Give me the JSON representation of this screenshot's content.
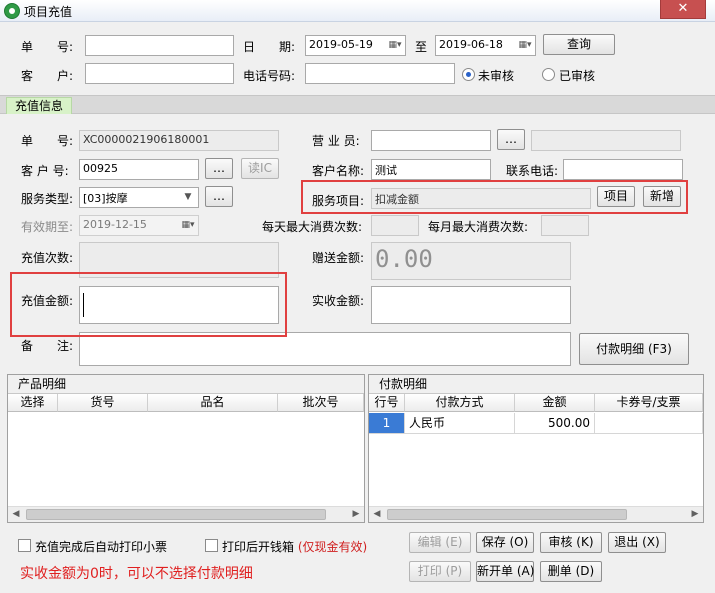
{
  "window": {
    "title": "项目充值",
    "close_glyph": "✕"
  },
  "search": {
    "order_no_label": "单　　号:",
    "date_label": "日　　期:",
    "date_from": "2019-05-19",
    "to_label": "至",
    "date_to": "2019-06-18",
    "query_button": "查询",
    "customer_label": "客　　户:",
    "phone_label": "电话号码:",
    "unaudited_label": "未审核",
    "audited_label": "已审核"
  },
  "section": {
    "title": "充值信息"
  },
  "form": {
    "order_no_label": "单　　号:",
    "order_no": "XC0000021906180001",
    "salesperson_label": "营 业 员:",
    "customer_no_label": "客 户 号:",
    "customer_no": "00925",
    "read_ic_button": "读IC",
    "customer_name_label": "客户名称:",
    "customer_name": "测试",
    "contact_phone_label": "联系电话:",
    "service_type_label": "服务类型:",
    "service_type": "[03]按摩",
    "service_item_label": "服务项目:",
    "service_item": "扣减金额",
    "item_button": "项目",
    "add_button": "新增",
    "valid_until_label": "有效期至:",
    "valid_until": "2019-12-15",
    "daily_max_label": "每天最大消费次数:",
    "monthly_max_label": "每月最大消费次数:",
    "recharge_count_label": "充值次数:",
    "bonus_amount_label": "赠送金额:",
    "bonus_amount": "0.00",
    "recharge_amount_label": "充值金额:",
    "received_amount_label": "实收金额:",
    "remark_label": "备　　注:",
    "payment_detail_button": "付款明细 (F3)",
    "ellipsis": "…"
  },
  "product_panel": {
    "title": "产品明细",
    "columns": [
      "选择",
      "货号",
      "品名",
      "批次号"
    ]
  },
  "payment_panel": {
    "title": "付款明细",
    "columns": [
      "行号",
      "付款方式",
      "金额",
      "卡券号/支票"
    ],
    "rows": [
      {
        "no": "1",
        "method": "人民币",
        "amount": "500.00",
        "card": ""
      }
    ]
  },
  "footer": {
    "auto_print_label": "充值完成后自动打印小票",
    "open_drawer_label": "打印后开钱箱",
    "open_drawer_hint": "(仅现金有效)",
    "edit_button": "编辑 (E)",
    "save_button": "保存 (O)",
    "audit_button": "审核 (K)",
    "exit_button": "退出 (X)",
    "print_button": "打印 (P)",
    "new_button": "新开单 (A)",
    "delete_button": "删单 (D)",
    "note": "实收金额为0时，可以不选择付款明细"
  },
  "colors": {
    "highlight": "#e04040",
    "selected_cell": "#3a7bd5"
  }
}
